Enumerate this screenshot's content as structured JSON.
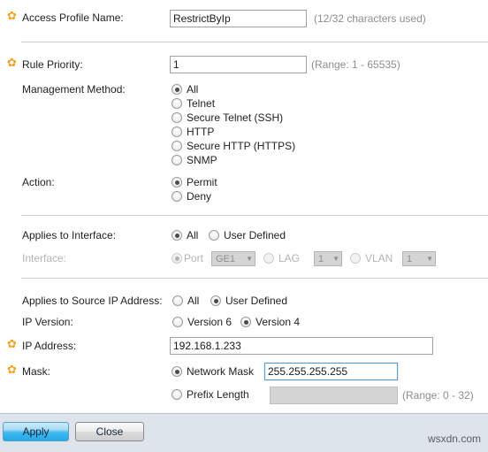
{
  "form": {
    "access_profile": {
      "label": "Access Profile Name:",
      "value": "RestrictByIp",
      "hint": "(12/32 characters used)",
      "required_icon": "asterisk-icon"
    },
    "rule_priority": {
      "label": "Rule Priority:",
      "value": "1",
      "hint": "(Range: 1 - 65535)",
      "required_icon": "asterisk-icon"
    },
    "management_method": {
      "label": "Management Method:",
      "options": [
        {
          "label": "All",
          "selected": true
        },
        {
          "label": "Telnet",
          "selected": false
        },
        {
          "label": "Secure Telnet (SSH)",
          "selected": false
        },
        {
          "label": "HTTP",
          "selected": false
        },
        {
          "label": "Secure HTTP (HTTPS)",
          "selected": false
        },
        {
          "label": "SNMP",
          "selected": false
        }
      ]
    },
    "action": {
      "label": "Action:",
      "options": [
        {
          "label": "Permit",
          "selected": true
        },
        {
          "label": "Deny",
          "selected": false
        }
      ]
    },
    "applies_to_interface": {
      "label": "Applies to Interface:",
      "options": [
        {
          "label": "All",
          "selected": true
        },
        {
          "label": "User Defined",
          "selected": false
        }
      ]
    },
    "interface": {
      "label": "Interface:",
      "disabled": true,
      "port": {
        "label": "Port",
        "selected": true,
        "value": "GE1"
      },
      "lag": {
        "label": "LAG",
        "selected": false,
        "value": "1"
      },
      "vlan": {
        "label": "VLAN",
        "selected": false,
        "value": "1"
      }
    },
    "applies_to_source_ip": {
      "label": "Applies to Source IP Address:",
      "options": [
        {
          "label": "All",
          "selected": false
        },
        {
          "label": "User Defined",
          "selected": true
        }
      ]
    },
    "ip_version": {
      "label": "IP Version:",
      "options": [
        {
          "label": "Version 6",
          "selected": false
        },
        {
          "label": "Version 4",
          "selected": true
        }
      ]
    },
    "ip_address": {
      "label": "IP Address:",
      "value": "192.168.1.233",
      "required_icon": "asterisk-icon"
    },
    "mask": {
      "label": "Mask:",
      "required_icon": "asterisk-icon",
      "network_mask": {
        "label": "Network Mask",
        "selected": true,
        "value": "255.255.255.255"
      },
      "prefix_length": {
        "label": "Prefix Length",
        "selected": false,
        "value": "",
        "hint": "(Range: 0 - 32)",
        "disabled": true
      }
    }
  },
  "footer": {
    "apply_label": "Apply",
    "close_label": "Close"
  },
  "watermark": "wsxdn.com",
  "icons": {
    "asterisk": "✿",
    "caret_down": "▼"
  },
  "colors": {
    "required_marker": "#f0a01e",
    "focus_border": "#5c9ccc",
    "footer_bg": "#dde4ec",
    "apply_accent": "#25a9e8"
  }
}
